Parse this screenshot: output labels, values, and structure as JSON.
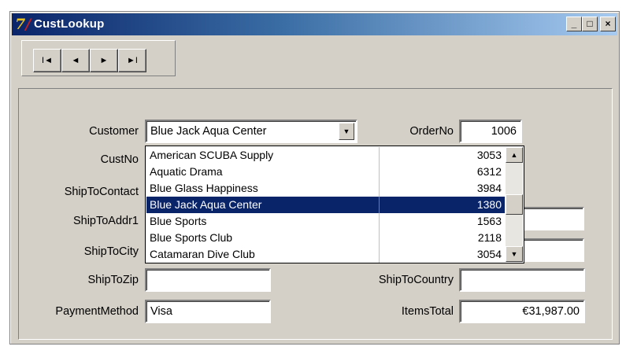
{
  "window": {
    "title": "CustLookup",
    "icon_name": "delphi-app-icon",
    "controls": {
      "minimize": "_",
      "maximize": "□",
      "close": "×"
    }
  },
  "navigator": [
    {
      "name": "first-record-button",
      "glyph": "I◄"
    },
    {
      "name": "prior-record-button",
      "glyph": "◄"
    },
    {
      "name": "next-record-button",
      "glyph": "►"
    },
    {
      "name": "last-record-button",
      "glyph": "►I"
    }
  ],
  "form": {
    "customer": {
      "label": "Customer",
      "value": "Blue Jack Aqua Center"
    },
    "orderno": {
      "label": "OrderNo",
      "value": "1006"
    },
    "custno": {
      "label": "CustNo"
    },
    "shiptocontact": {
      "label": "ShipToContact"
    },
    "shiptoaddr1": {
      "label": "ShipToAddr1"
    },
    "shiptocity": {
      "label": "ShipToCity"
    },
    "shiptozip": {
      "label": "ShipToZip",
      "value": ""
    },
    "shiptocountry": {
      "label": "ShipToCountry",
      "value": ""
    },
    "paymentmethod": {
      "label": "PaymentMethod",
      "value": "Visa"
    },
    "itemstotal": {
      "label": "ItemsTotal",
      "value": "€31,987.00"
    }
  },
  "dropdown": {
    "rows": [
      {
        "name": "American SCUBA Supply",
        "num": "3053"
      },
      {
        "name": "Aquatic Drama",
        "num": "6312"
      },
      {
        "name": "Blue Glass Happiness",
        "num": "3984"
      },
      {
        "name": "Blue Jack Aqua Center",
        "num": "1380"
      },
      {
        "name": "Blue Sports",
        "num": "1563"
      },
      {
        "name": "Blue Sports Club",
        "num": "2118"
      },
      {
        "name": "Catamaran Dive Club",
        "num": "3054"
      }
    ],
    "selected_index": 3,
    "scroll_up_glyph": "▲",
    "scroll_down_glyph": "▼"
  },
  "colors": {
    "selection": "#0a246a",
    "face": "#d4d0c8",
    "title_gradient_start": "#0a246a"
  }
}
